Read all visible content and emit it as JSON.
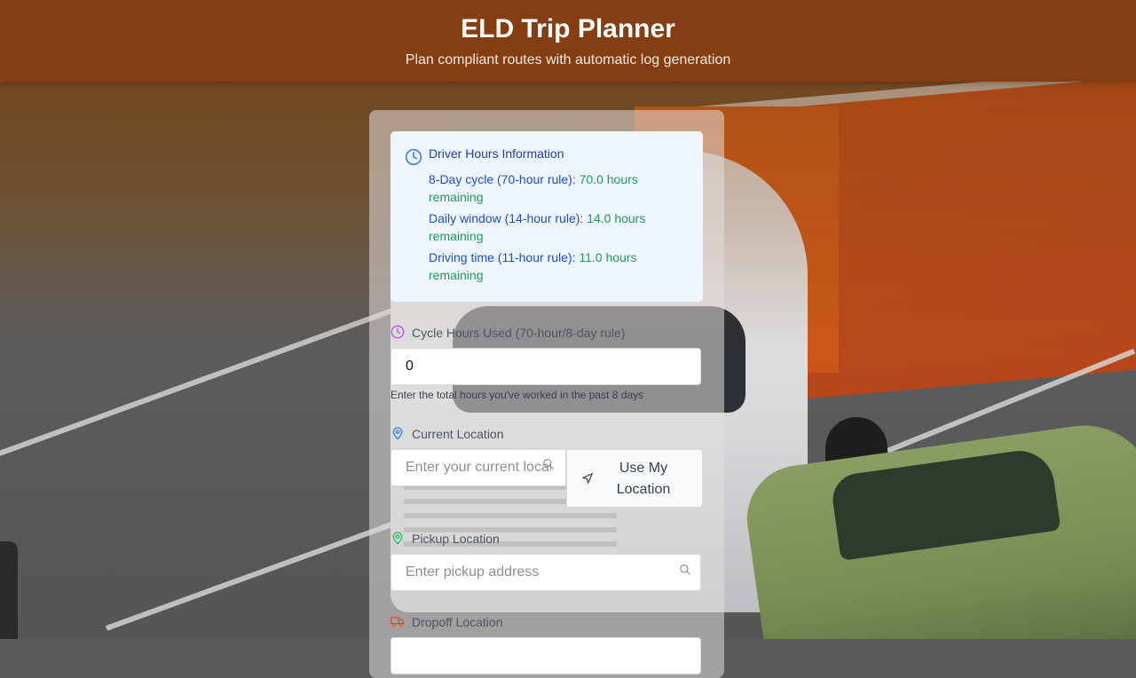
{
  "header": {
    "title": "ELD Trip Planner",
    "subtitle": "Plan compliant routes with automatic log generation"
  },
  "hours_info": {
    "title": "Driver Hours Information",
    "rows": [
      {
        "label": "8-Day cycle (70-hour rule):",
        "value": "70.0 hours",
        "suffix": "remaining"
      },
      {
        "label": "Daily window (14-hour rule):",
        "value": "14.0 hours",
        "suffix": "remaining"
      },
      {
        "label": "Driving time (11-hour rule):",
        "value": "11.0 hours",
        "suffix": "remaining"
      }
    ]
  },
  "form": {
    "cycle_hours": {
      "label": "Cycle Hours Used (70-hour/8-day rule)",
      "value": "0",
      "hint": "Enter the total hours you've worked in the past 8 days"
    },
    "current_location": {
      "label": "Current Location",
      "placeholder": "Enter your current location",
      "button_label": "Use My Location"
    },
    "pickup_location": {
      "label": "Pickup Location",
      "placeholder": "Enter pickup address"
    },
    "dropoff_location": {
      "label": "Dropoff Location"
    }
  },
  "colors": {
    "header_bg": "#853d12",
    "info_title": "#1e429f",
    "info_value": "#1f9d55",
    "cycle_icon": "#a855f7",
    "current_icon": "#3b82f6",
    "pickup_icon": "#22c55e",
    "dropoff_icon": "#ef4444"
  },
  "icons": {
    "info": "clock-icon",
    "cycle": "clock-icon",
    "current": "map-pin-icon",
    "pickup": "map-pin-icon",
    "dropoff": "truck-icon",
    "search": "search-icon",
    "locate": "navigation-icon"
  }
}
